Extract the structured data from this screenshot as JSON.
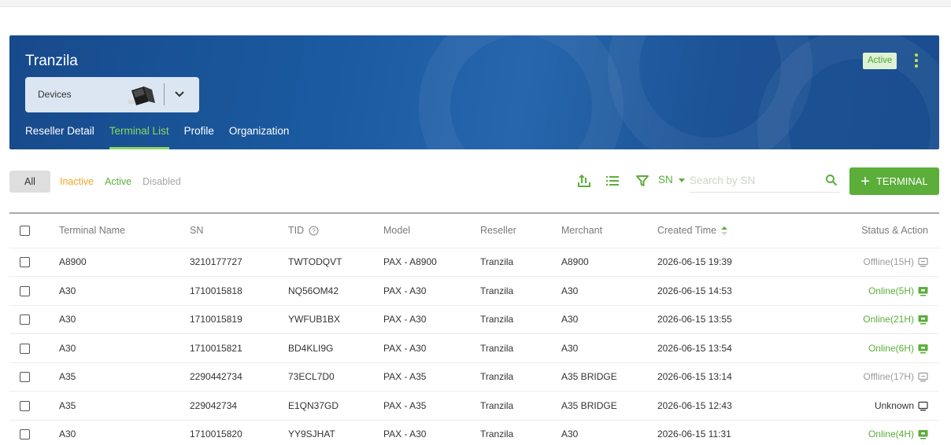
{
  "banner": {
    "title": "Tranzila",
    "status_badge": "Active",
    "devices_label": "Devices",
    "tabs": [
      {
        "label": "Reseller Detail",
        "active": false
      },
      {
        "label": "Terminal List",
        "active": true
      },
      {
        "label": "Profile",
        "active": false
      },
      {
        "label": "Organization",
        "active": false
      }
    ]
  },
  "filters": {
    "all": "All",
    "inactive": "Inactive",
    "active": "Active",
    "disabled": "Disabled"
  },
  "toolbar": {
    "search_field": "SN",
    "search_placeholder": "Search by SN",
    "add_button": "TERMINAL",
    "icons": [
      "export-icon",
      "list-view-icon",
      "filter-icon",
      "search-icon"
    ]
  },
  "table": {
    "columns": [
      "Terminal Name",
      "SN",
      "TID",
      "Model",
      "Reseller",
      "Merchant",
      "Created Time",
      "Status & Action"
    ],
    "rows": [
      {
        "name": "A8900",
        "sn": "3210177727",
        "tid": "TWTODQVT",
        "model": "PAX - A8900",
        "reseller": "Tranzila",
        "merchant": "A8900",
        "created": "2026-06-15 19:39",
        "status": "Offline(15H)",
        "state": "offline"
      },
      {
        "name": "A30",
        "sn": "1710015818",
        "tid": "NQ56OM42",
        "model": "PAX - A30",
        "reseller": "Tranzila",
        "merchant": "A30",
        "created": "2026-06-15 14:53",
        "status": "Online(5H)",
        "state": "online"
      },
      {
        "name": "A30",
        "sn": "1710015819",
        "tid": "YWFUB1BX",
        "model": "PAX - A30",
        "reseller": "Tranzila",
        "merchant": "A30",
        "created": "2026-06-15 13:55",
        "status": "Online(21H)",
        "state": "online"
      },
      {
        "name": "A30",
        "sn": "1710015821",
        "tid": "BD4KLI9G",
        "model": "PAX - A30",
        "reseller": "Tranzila",
        "merchant": "A30",
        "created": "2026-06-15 13:54",
        "status": "Online(6H)",
        "state": "online"
      },
      {
        "name": "A35",
        "sn": "2290442734",
        "tid": "73ECL7D0",
        "model": "PAX - A35",
        "reseller": "Tranzila",
        "merchant": "A35 BRIDGE",
        "created": "2026-06-15 13:14",
        "status": "Offline(17H)",
        "state": "offline"
      },
      {
        "name": "A35",
        "sn": "229042734",
        "tid": "E1QN37GD",
        "model": "PAX - A35",
        "reseller": "Tranzila",
        "merchant": "A35 BRIDGE",
        "created": "2026-06-15 12:43",
        "status": "Unknown",
        "state": "unknown"
      },
      {
        "name": "A30",
        "sn": "1710015820",
        "tid": "YY9SJHAT",
        "model": "PAX - A30",
        "reseller": "Tranzila",
        "merchant": "A30",
        "created": "2026-06-15 11:31",
        "status": "Online(4H)",
        "state": "online"
      }
    ]
  },
  "colors": {
    "banner": "#1b5aa1",
    "accent_green": "#5bae3a",
    "inactive_orange": "#f5a322",
    "offline_gray": "#9b9b9b"
  }
}
